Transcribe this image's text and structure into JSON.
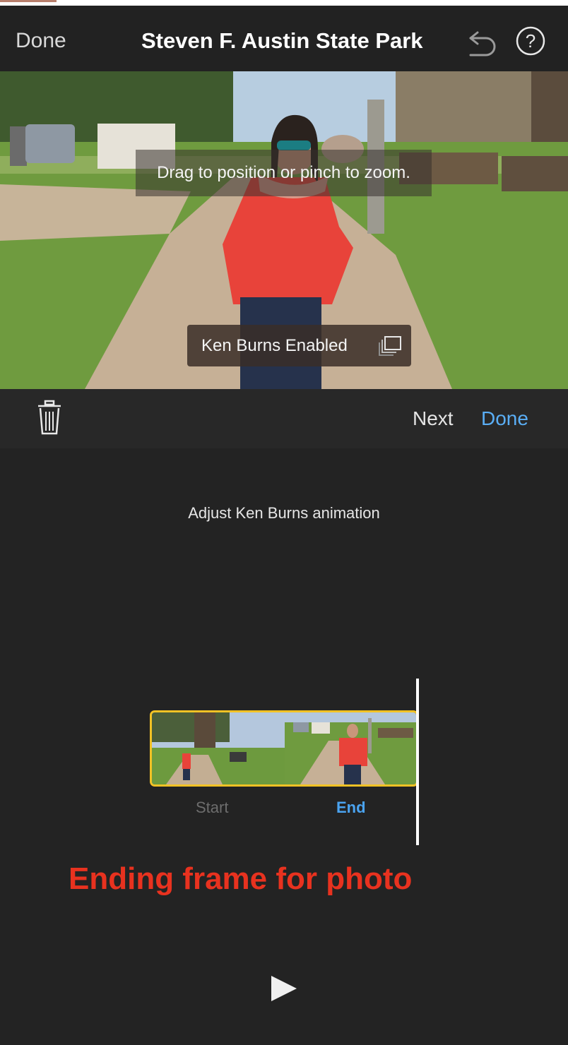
{
  "nav": {
    "done_label": "Done",
    "title": "Steven F. Austin State Park",
    "undo_icon": "undo-icon",
    "help_icon": "help-icon"
  },
  "preview": {
    "hint": "Drag to position or pinch to zoom.",
    "ken_burns_label": "Ken Burns Enabled",
    "ken_burns_icon": "ken-burns-icon"
  },
  "toolbar": {
    "trash_icon": "trash-icon",
    "next_label": "Next",
    "done_label": "Done"
  },
  "editor": {
    "adjust_label": "Adjust Ken Burns animation",
    "start_label": "Start",
    "end_label": "End",
    "annotation": "Ending frame for photo",
    "play_icon": "play-icon"
  },
  "colors": {
    "accent_blue": "#5aaef5",
    "selection_yellow": "#f2c225",
    "annotation_red": "#e8321f"
  }
}
